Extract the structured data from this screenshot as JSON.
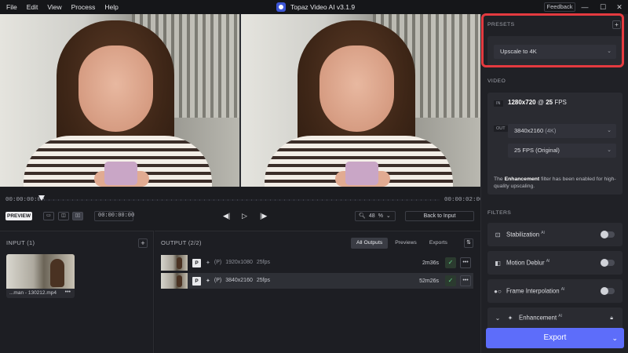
{
  "menu": [
    "File",
    "Edit",
    "View",
    "Process",
    "Help"
  ],
  "app_title": "Topaz Video AI  v3.1.9",
  "feedback_label": "Feedback",
  "window_controls": {
    "minimize": "—",
    "maximize": "☐",
    "close": "✕"
  },
  "timeline": {
    "start_time": "00:00:00:00",
    "end_time": "00:00:02:00",
    "preview_label": "PREVIEW",
    "timecode": "00:00:00:00",
    "zoom": "48",
    "zoom_unit": "%",
    "back_label": "Back to Input"
  },
  "input": {
    "title": "INPUT (1)",
    "file_name": "...man - 130212.mp4"
  },
  "output": {
    "title": "OUTPUT (2/2)",
    "tabs": [
      "All Outputs",
      "Previews",
      "Exports"
    ],
    "rows": [
      {
        "badge": "P",
        "mode": "(P)",
        "resolution": "1920x1080",
        "fps": "25fps",
        "time": "2m36s"
      },
      {
        "badge": "P",
        "mode": "(P)",
        "resolution": "3840x2160",
        "fps": "25fps",
        "time": "52m26s"
      }
    ]
  },
  "sidebar": {
    "presets_title": "PRESETS",
    "preset_value": "Upscale to 4K",
    "video_title": "VIDEO",
    "in_tag": "IN",
    "out_tag": "OUT",
    "source_res": "1280x720",
    "source_at": "@",
    "source_fps": "25",
    "source_fps_unit": "FPS",
    "output_res": "3840x2160",
    "output_res_note": "(4K)",
    "output_fps": "25 FPS (Original)",
    "note_prefix": "The",
    "note_bold": "Enhancement",
    "note_suffix": "filter has been enabled for high-quality upscaling.",
    "filters_title": "FILTERS",
    "filters": [
      {
        "label": "Stabilization",
        "ai": "AI"
      },
      {
        "label": "Motion Deblur",
        "ai": "AI"
      },
      {
        "label": "Frame Interpolation",
        "ai": "AI"
      },
      {
        "label": "Enhancement",
        "ai": "AI"
      }
    ],
    "export_label": "Export"
  }
}
